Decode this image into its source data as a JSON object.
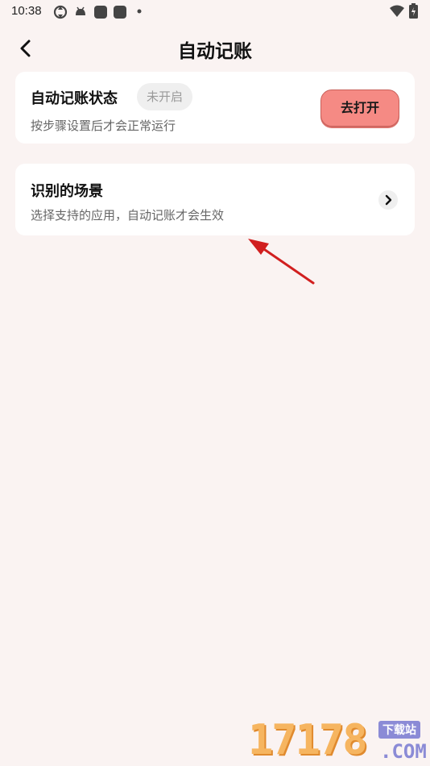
{
  "status_bar": {
    "time": "10:38",
    "icons": [
      "sync-icon",
      "android-icon",
      "app-icon",
      "app-icon",
      "dot-icon",
      "wifi-icon",
      "battery-icon"
    ]
  },
  "header": {
    "title": "自动记账",
    "back_icon": "chevron-left-icon"
  },
  "status_card": {
    "title": "自动记账状态",
    "badge": "未开启",
    "description": "按步骤设置后才会正常运行",
    "button_label": "去打开",
    "button_color": "#f58a84"
  },
  "scene_card": {
    "title": "识别的场景",
    "description": "选择支持的应用，自动记账才会生效",
    "chevron_icon": "chevron-right-icon"
  },
  "annotation": {
    "arrow_color": "#d11f1f"
  },
  "watermark": {
    "digits": "17178",
    "tag": "下载站",
    "suffix": ".COM"
  }
}
